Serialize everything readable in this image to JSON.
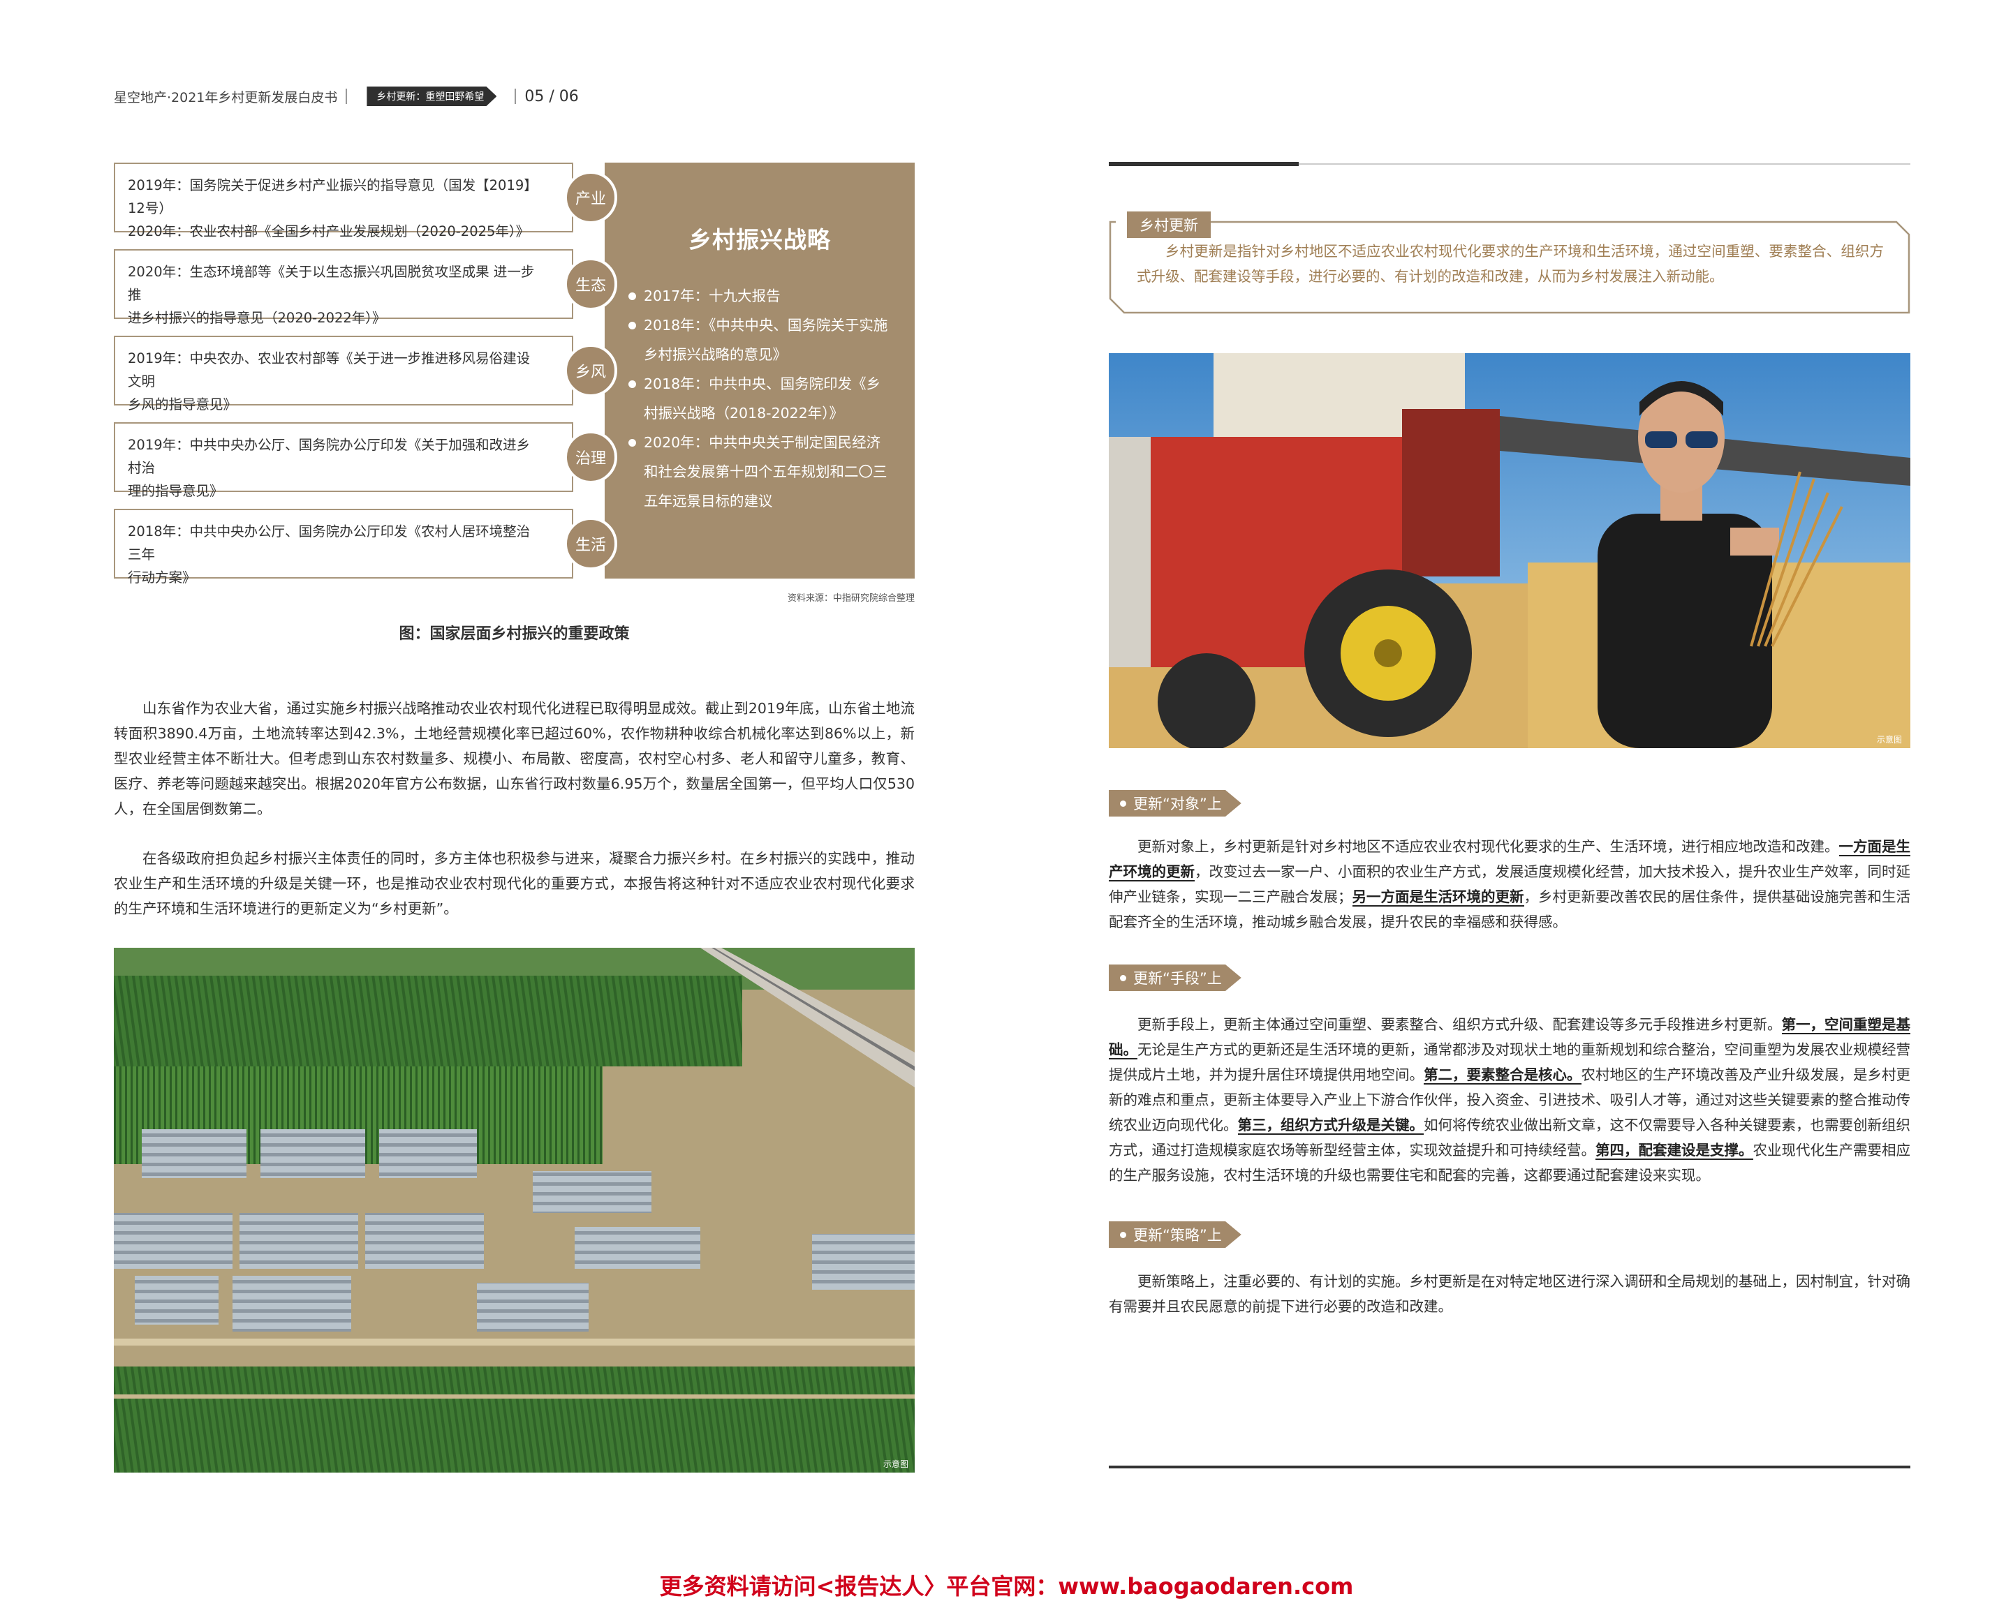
{
  "header": {
    "title": "星空地产·2021年乡村更新发展白皮书",
    "section": "乡村更新：重塑田野希望",
    "page": "05 / 06"
  },
  "diagram": {
    "policies": [
      {
        "category": "产业",
        "lines": [
          "2019年：国务院关于促进乡村产业振兴的指导意见（国发【2019】12号）",
          "2020年：农业农村部《全国乡村产业发展规划（2020-2025年）》"
        ]
      },
      {
        "category": "生态",
        "lines": [
          "2020年：生态环境部等《关于以生态振兴巩固脱贫攻坚成果 进一步推",
          "进乡村振兴的指导意见（2020-2022年）》"
        ]
      },
      {
        "category": "乡风",
        "lines": [
          "2019年：中央农办、农业农村部等《关于进一步推进移风易俗建设文明",
          "乡风的指导意见》"
        ]
      },
      {
        "category": "治理",
        "lines": [
          "2019年：中共中央办公厅、国务院办公厅印发《关于加强和改进乡村治",
          "理的指导意见》"
        ]
      },
      {
        "category": "生活",
        "lines": [
          "2018年：中共中央办公厅、国务院办公厅印发《农村人居环境整治三年",
          "行动方案》"
        ]
      }
    ],
    "strategy_title": "乡村振兴战略",
    "strategy_items": [
      "2017年：十九大报告",
      "2018年：《中共中央、国务院关于实施乡村振兴战略的意见》",
      "2018年：中共中央、国务院印发《乡村振兴战略（2018-2022年）》",
      "2020年：中共中央关于制定国民经济和社会发展第十四个五年规划和二〇三五年远景目标的建议"
    ],
    "source": "资料来源：中指研究院综合整理",
    "caption": "图：国家层面乡村振兴的重要政策"
  },
  "left_text": {
    "p1": "山东省作为农业大省，通过实施乡村振兴战略推动农业农村现代化进程已取得明显成效。截止到2019年底，山东省土地流转面积3890.4万亩，土地流转率达到42.3%，土地经营规模化率已超过60%，农作物耕种收综合机械化率达到86%以上，新型农业经营主体不断壮大。但考虑到山东农村数量多、规模小、布局散、密度高，农村空心村多、老人和留守儿童多，教育、医疗、养老等问题越来越突出。根据2020年官方公布数据，山东省行政村数量6.95万个，数量居全国第一，但平均人口仅530人，在全国居倒数第二。",
    "p2": "在各级政府担负起乡村振兴主体责任的同时，多方主体也积极参与进来，凝聚合力振兴乡村。在乡村振兴的实践中，推动农业生产和生活环境的升级是关键一环，也是推动农业农村现代化的重要方式，本报告将这种针对不适应农业农村现代化要求的生产环境和生活环境进行的更新定义为“乡村更新”。"
  },
  "photo_watermark": "示意图",
  "definition": {
    "tag": "乡村更新",
    "text": "乡村更新是指针对乡村地区不适应农业农村现代化要求的生产环境和生活环境，通过空间重塑、要素整合、组织方式升级、配套建设等手段，进行必要的、有计划的改造和改建，从而为乡村发展注入新动能。"
  },
  "sections": {
    "object": {
      "tag": "更新“对象”上",
      "t1": "更新对象上，乡村更新是针对乡村地区不适应农业农村现代化要求的生产、生活环境，进行相应地改造和改建。",
      "b1": "一方面是生产环境的更新",
      "t2": "，改变过去一家一户、小面积的农业生产方式，发展适度规模化经营，加大技术投入，提升农业生产效率，同时延伸产业链条，实现一二三产融合发展；",
      "b2": "另一方面是生活环境的更新",
      "t3": "，乡村更新要改善农民的居住条件，提供基础设施完善和生活配套齐全的生活环境，推动城乡融合发展，提升农民的幸福感和获得感。"
    },
    "means": {
      "tag": "更新“手段”上",
      "t1": "更新手段上，更新主体通过空间重塑、要素整合、组织方式升级、配套建设等多元手段推进乡村更新。",
      "b1": "第一，空间重塑是基础。",
      "t2": "无论是生产方式的更新还是生活环境的更新，通常都涉及对现状土地的重新规划和综合整治，空间重塑为发展农业规模经营提供成片土地，并为提升居住环境提供用地空间。",
      "b2": "第二，要素整合是核心。",
      "t3": "农村地区的生产环境改善及产业升级发展，是乡村更新的难点和重点，更新主体要导入产业上下游合作伙伴，投入资金、引进技术、吸引人才等，通过对这些关键要素的整合推动传统农业迈向现代化。",
      "b3": "第三，组织方式升级是关键。",
      "t4": "如何将传统农业做出新文章，这不仅需要导入各种关键要素，也需要创新组织方式，通过打造规模家庭农场等新型经营主体，实现效益提升和可持续经营。",
      "b4": "第四，配套建设是支撑。",
      "t5": "农业现代化生产需要相应的生产服务设施，农村生活环境的升级也需要住宅和配套的完善，这都要通过配套建设来实现。"
    },
    "strategy": {
      "tag": "更新“策略”上",
      "t1": "更新策略上，注重必要的、有计划的实施。乡村更新是在对特定地区进行深入调研和全局规划的基础上，因村制宜，针对确有需要并且农民愿意的前提下进行必要的改造和改建。"
    }
  },
  "footer": "更多资料请访问<报告达人〉平台官网：www.baogaodaren.com"
}
